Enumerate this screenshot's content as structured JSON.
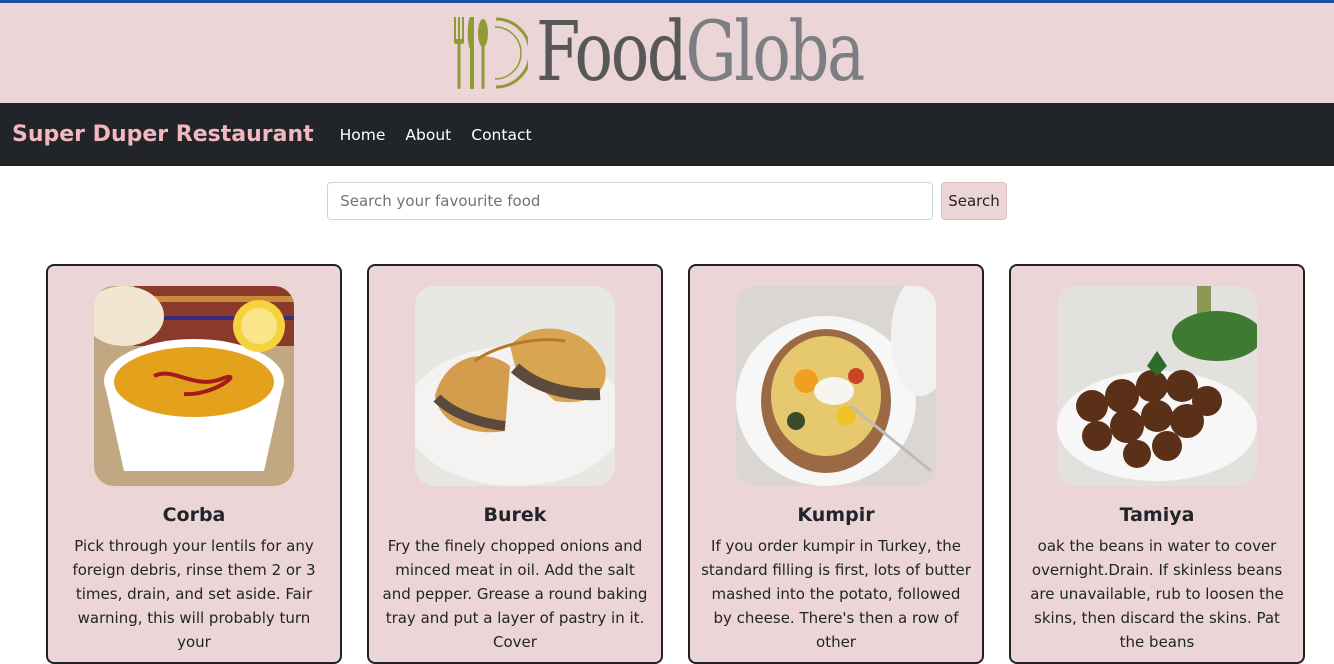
{
  "banner": {
    "logo_text_food": "Food",
    "logo_text_globa": "Globa",
    "logo_colors": {
      "mark": "#8f9b35",
      "food": "#57575a",
      "globa": "#7c7e83"
    }
  },
  "navbar": {
    "brand": "Super Duper Restaurant",
    "links": [
      "Home",
      "About",
      "Contact"
    ],
    "background": "#212529",
    "brand_color": "#f4b7bd"
  },
  "search": {
    "placeholder": "Search your favourite food",
    "value": "",
    "button_label": "Search"
  },
  "cards": [
    {
      "title": "Corba",
      "image": "lentil-soup-photo",
      "text": "Pick through your lentils for any foreign debris, rinse them 2 or 3 times, drain, and set aside. Fair warning, this will probably turn your"
    },
    {
      "title": "Burek",
      "image": "burek-pastry-photo",
      "text": "Fry the finely chopped onions and minced meat in oil. Add the salt and pepper. Grease a round baking tray and put a layer of pastry in it. Cover"
    },
    {
      "title": "Kumpir",
      "image": "stuffed-potato-photo",
      "text": "If you order kumpir in Turkey, the standard filling is first, lots of butter mashed into the potato, followed by cheese. There's then a row of other"
    },
    {
      "title": "Tamiya",
      "image": "falafel-photo",
      "text": "oak the beans in water to cover overnight.Drain. If skinless beans are unavailable, rub to loosen the skins, then discard the skins. Pat the beans"
    }
  ],
  "colors": {
    "card_bg": "#ebd5d6",
    "banner_bg": "#ebd5d6",
    "top_rule": "#1d4f9a"
  }
}
